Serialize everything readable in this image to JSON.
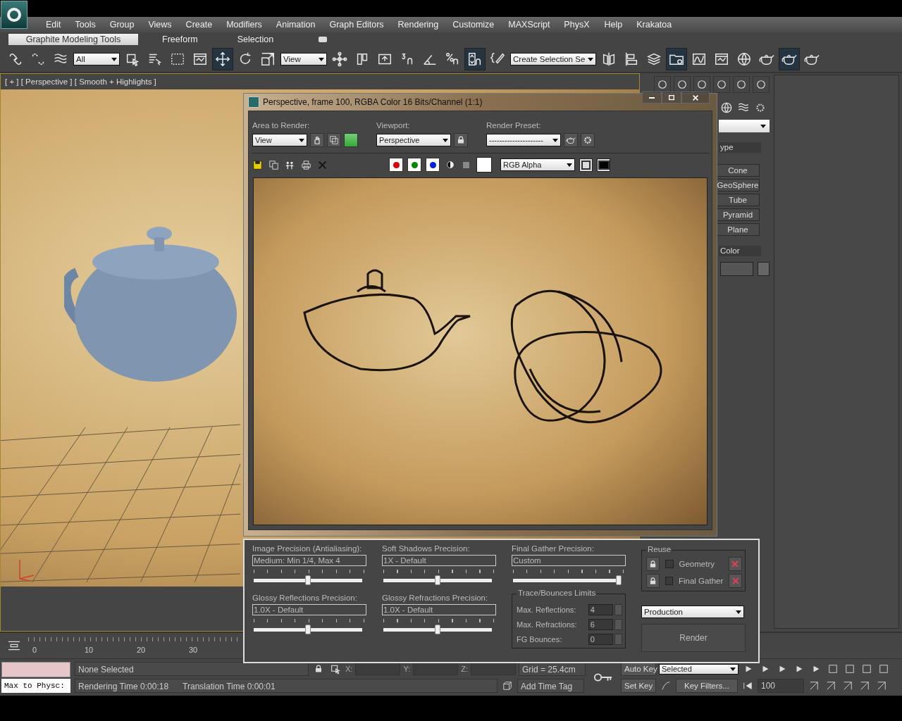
{
  "menu": [
    "Edit",
    "Tools",
    "Group",
    "Views",
    "Create",
    "Modifiers",
    "Animation",
    "Graph Editors",
    "Rendering",
    "Customize",
    "MAXScript",
    "PhysX",
    "Help",
    "Krakatoa"
  ],
  "ribbon_tabs": [
    {
      "label": "Graphite Modeling Tools",
      "selected": true
    },
    {
      "label": "Freeform",
      "selected": false
    },
    {
      "label": "Selection",
      "selected": false
    }
  ],
  "toolbar": [
    {
      "kind": "link",
      "selected": false
    },
    {
      "kind": "unlink",
      "selected": false
    },
    {
      "kind": "waves",
      "selected": false
    },
    {
      "kind": "dropdown",
      "value": "All",
      "selected": false
    },
    {
      "kind": "select",
      "selected": false
    },
    {
      "kind": "list",
      "selected": false
    },
    {
      "kind": "rect",
      "selected": false
    },
    {
      "kind": "window",
      "selected": false
    },
    {
      "kind": "move",
      "selected": true
    },
    {
      "kind": "rotate",
      "selected": false
    },
    {
      "kind": "scale",
      "selected": false
    },
    {
      "kind": "dropdown",
      "value": "View",
      "selected": false
    },
    {
      "kind": "pivot",
      "selected": false
    },
    {
      "kind": "nodes",
      "selected": false
    },
    {
      "kind": "upload",
      "selected": false
    },
    {
      "kind": "snap",
      "selected": false
    },
    {
      "kind": "angle",
      "selected": false
    },
    {
      "kind": "percent",
      "selected": false
    },
    {
      "kind": "spinner",
      "selected": true
    },
    {
      "kind": "braces",
      "selected": false
    },
    {
      "kind": "dropdown",
      "value": "Create Selection Se",
      "selected": false
    },
    {
      "kind": "mirror",
      "selected": false
    },
    {
      "kind": "align",
      "selected": false
    },
    {
      "kind": "layers",
      "selected": false
    },
    {
      "kind": "folder",
      "selected": true
    },
    {
      "kind": "curve",
      "selected": false
    },
    {
      "kind": "window",
      "selected": false
    },
    {
      "kind": "sphere",
      "selected": false
    },
    {
      "kind": "teapot",
      "selected": false
    },
    {
      "kind": "teapot",
      "selected": true
    },
    {
      "kind": "teapot",
      "selected": false
    }
  ],
  "viewport": {
    "label": "[ + ] [ Perspective ] [ Smooth + Highlights ]"
  },
  "command_panel": {
    "rollout_1": "ype",
    "buttons": [
      "Cone",
      "GeoSphere",
      "Tube",
      "Pyramid",
      "Plane"
    ],
    "rollout_2": "Color"
  },
  "render_window": {
    "title": "Perspective, frame 100, RGBA Color 16 Bits/Channel (1:1)",
    "area_label": "Area to Render:",
    "area_value": "View",
    "viewport_label": "Viewport:",
    "viewport_value": "Perspective",
    "preset_label": "Render Preset:",
    "preset_value": "---------------------",
    "channels": [
      {
        "color": "#e00000"
      },
      {
        "color": "#008a00"
      },
      {
        "color": "#0020e0"
      }
    ],
    "display": "RGB Alpha"
  },
  "render_settings": {
    "sliders": [
      {
        "label": "Image Precision (Antialiasing):",
        "value": "Medium: Min 1/4, Max 4",
        "level": 0.5
      },
      {
        "label": "Soft Shadows Precision:",
        "value": "1X - Default",
        "level": 0.5
      },
      {
        "label": "Final Gather Precision:",
        "value": "Custom",
        "level": 1
      },
      {
        "label": "Glossy Reflections Precision:",
        "value": "1.0X - Default",
        "level": 0.5
      },
      {
        "label": "Glossy Refractions Precision:",
        "value": "1.0X - Default",
        "level": 0.5
      }
    ],
    "limits_title": "Trace/Bounces Limits",
    "limits": [
      {
        "label": "Max. Reflections:",
        "value": "4"
      },
      {
        "label": "Max. Refractions:",
        "value": "6"
      },
      {
        "label": "FG Bounces:",
        "value": "0"
      }
    ],
    "reuse_title": "Reuse",
    "reuse": [
      {
        "label": "Geometry",
        "checked": false
      },
      {
        "label": "Final Gather",
        "checked": false
      }
    ],
    "mode": "Production",
    "render_button": "Render"
  },
  "timeline": {
    "ticks": [
      "0",
      "10",
      "20",
      "30"
    ]
  },
  "status_bar": {
    "listener": "Max to Physc:",
    "selection": "None Selected",
    "prompt_1": "Rendering Time  0:00:18",
    "prompt_2": "Translation Time  0:00:01",
    "x_label": "X:",
    "y_label": "Y:",
    "z_label": "Z:",
    "grid": "Grid = 25.4cm",
    "time_tag": "Add Time Tag",
    "auto_key": "Auto Key",
    "key_set": "Selected",
    "set_key": "Set Key",
    "key_filters": "Key Filters...",
    "frame": "100"
  }
}
